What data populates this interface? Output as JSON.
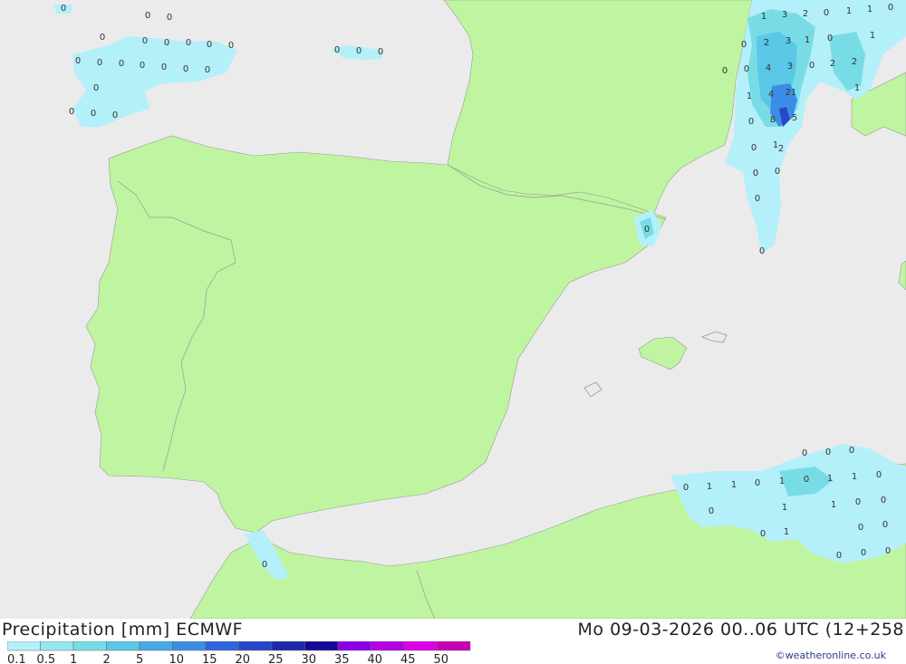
{
  "header": {
    "product": "Precipitation [mm]",
    "model": "ECMWF",
    "valid_time": "Mo 09-03-2026 00..06 UTC (12+258"
  },
  "credit": "©weatheronline.co.uk",
  "legend": {
    "ticks": [
      "0.1",
      "0.5",
      "1",
      "2",
      "5",
      "10",
      "15",
      "20",
      "25",
      "30",
      "35",
      "40",
      "45",
      "50"
    ],
    "colors": [
      "#b4f0fa",
      "#96e6f0",
      "#78dce6",
      "#5ac8e6",
      "#46aae6",
      "#3c8ce6",
      "#3264dc",
      "#2846c8",
      "#1e28aa",
      "#140a96",
      "#8c00e6",
      "#b400e6",
      "#dc00e6",
      "#c800b4"
    ]
  },
  "map_values": [
    "0",
    "0",
    "0",
    "0",
    "0",
    "0",
    "0",
    "0",
    "0",
    "0",
    "0",
    "0",
    "0",
    "0",
    "0",
    "0",
    "0",
    "0",
    "0",
    "0",
    "0",
    "0",
    "0",
    "0",
    "0",
    "0",
    "1",
    "3",
    "2",
    "0",
    "1",
    "1",
    "0",
    "0",
    "2",
    "3",
    "1",
    "0",
    "1",
    "0",
    "0",
    "4",
    "3",
    "0",
    "2",
    "2",
    "1",
    "1",
    "4",
    "21",
    "0",
    "8",
    "5",
    "0",
    "1",
    "0",
    "0",
    "0",
    "2",
    "0",
    "0",
    "0",
    "0",
    "1",
    "1",
    "0",
    "1",
    "0",
    "1",
    "1",
    "0",
    "0",
    "1",
    "1",
    "0",
    "0",
    "0",
    "0",
    "1",
    "0",
    "0",
    "0",
    "0",
    "0",
    "0",
    "1",
    "0",
    "0",
    "0"
  ]
}
